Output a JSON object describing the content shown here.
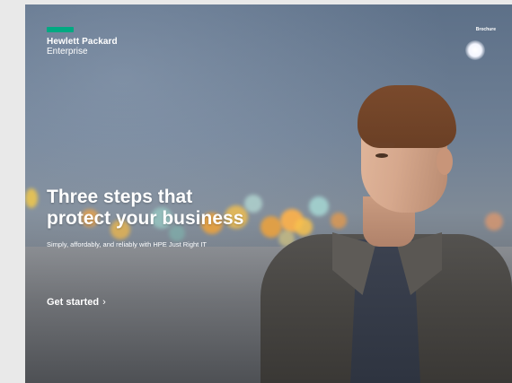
{
  "brand": {
    "line1": "Hewlett Packard",
    "line2": "Enterprise",
    "accent_color": "#01a982"
  },
  "nav": {
    "link_label": "Brochure"
  },
  "hero": {
    "headline_line1": "Three steps that",
    "headline_line2": "protect your business",
    "subtitle": "Simply, affordably, and reliably with HPE Just Right IT",
    "cta_label": "Get started",
    "cta_icon": "chevron-right-icon"
  }
}
